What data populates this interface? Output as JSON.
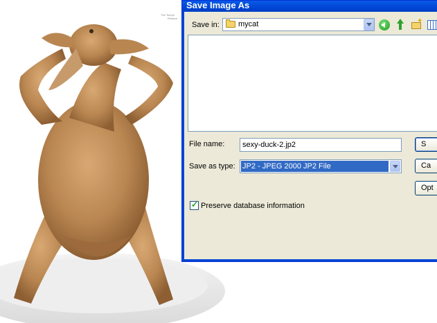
{
  "background": {
    "credit_line1": "The Tempe",
    "credit_line2": "Restaur"
  },
  "dialog": {
    "title": "Save Image As",
    "save_in_label": "Save in:",
    "save_in_value": "mycat",
    "toolbar_icons": [
      "back-icon",
      "up-folder-icon",
      "new-folder-icon",
      "views-icon"
    ],
    "file_name_label": "File name:",
    "file_name_value": "sexy-duck-2.jp2",
    "save_type_label": "Save as type:",
    "save_type_value": "JP2 - JPEG 2000 JP2 File",
    "save_button": "S",
    "cancel_button": "Ca",
    "options_button": "Opt",
    "preserve_label": "Preserve database information",
    "preserve_checked": true
  }
}
